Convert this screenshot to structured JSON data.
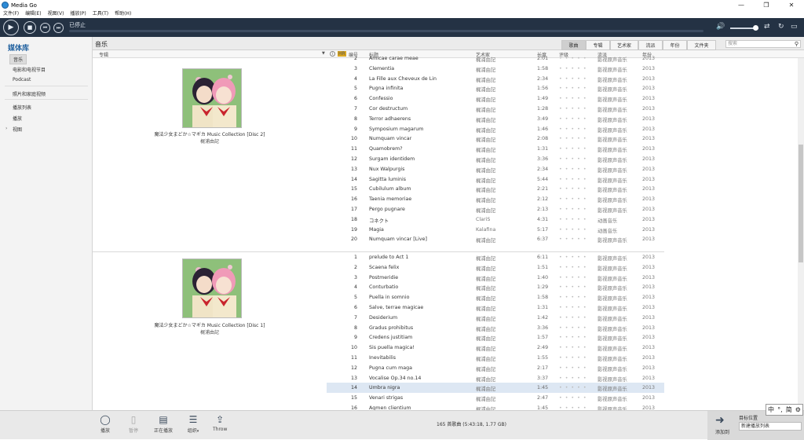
{
  "window": {
    "title": "Media Go",
    "minimize": "—",
    "restore": "❐",
    "close": "✕"
  },
  "menu": [
    "文件(F)",
    "编辑(E)",
    "视图(V)",
    "播放(P)",
    "工具(T)",
    "帮助(H)"
  ],
  "transport": {
    "status": "已停止"
  },
  "sidebar": {
    "title": "媒体库",
    "items": [
      "音乐",
      "电影和电视节目",
      "Podcast",
      "照片和家庭视频",
      "播放列表",
      "播放",
      "视图"
    ]
  },
  "section": {
    "title": "音乐",
    "view_tabs": [
      "歌曲",
      "专辑",
      "艺术家",
      "流派",
      "年份",
      "文件夹"
    ],
    "search_placeholder": "搜索"
  },
  "columns": {
    "album": "专辑",
    "hr": "HR",
    "number": "编号",
    "title": "标题",
    "artist": "艺术家",
    "length": "长度",
    "rating": "评级",
    "genre": "流派",
    "year": "年份"
  },
  "albums": [
    {
      "title": "魔法少女まどか☆マギカ Music Collection [Disc 2]",
      "artist": "梶浦由記"
    },
    {
      "title": "魔法少女まどか☆マギカ Music Collection [Disc 1]",
      "artist": "梶浦由記"
    }
  ],
  "tracks_disc2": [
    {
      "n": "2",
      "title": "Amicae carae meae",
      "artist": "梶浦由記",
      "len": "2:01",
      "genre": "影视原声音乐",
      "year": "2013"
    },
    {
      "n": "3",
      "title": "Clementia",
      "artist": "梶浦由記",
      "len": "1:58",
      "genre": "影视原声音乐",
      "year": "2013"
    },
    {
      "n": "4",
      "title": "La Fille aux Cheveux de Lin",
      "artist": "梶浦由記",
      "len": "2:34",
      "genre": "影视原声音乐",
      "year": "2013"
    },
    {
      "n": "5",
      "title": "Pugna infinita",
      "artist": "梶浦由記",
      "len": "1:56",
      "genre": "影视原声音乐",
      "year": "2013"
    },
    {
      "n": "6",
      "title": "Confessio",
      "artist": "梶浦由記",
      "len": "1:49",
      "genre": "影视原声音乐",
      "year": "2013"
    },
    {
      "n": "7",
      "title": "Cor destructum",
      "artist": "梶浦由記",
      "len": "1:28",
      "genre": "影视原声音乐",
      "year": "2013"
    },
    {
      "n": "8",
      "title": "Terror adhaerens",
      "artist": "梶浦由記",
      "len": "3:49",
      "genre": "影视原声音乐",
      "year": "2013"
    },
    {
      "n": "9",
      "title": "Symposium magarum",
      "artist": "梶浦由記",
      "len": "1:46",
      "genre": "影视原声音乐",
      "year": "2013"
    },
    {
      "n": "10",
      "title": "Numquam vincar",
      "artist": "梶浦由記",
      "len": "2:08",
      "genre": "影视原声音乐",
      "year": "2013"
    },
    {
      "n": "11",
      "title": "Quamobrem?",
      "artist": "梶浦由記",
      "len": "1:31",
      "genre": "影视原声音乐",
      "year": "2013"
    },
    {
      "n": "12",
      "title": "Surgam identidem",
      "artist": "梶浦由記",
      "len": "3:36",
      "genre": "影视原声音乐",
      "year": "2013"
    },
    {
      "n": "13",
      "title": "Nux Walpurgis",
      "artist": "梶浦由記",
      "len": "2:34",
      "genre": "影视原声音乐",
      "year": "2013"
    },
    {
      "n": "14",
      "title": "Sagitta luminis",
      "artist": "梶浦由記",
      "len": "5:44",
      "genre": "影视原声音乐",
      "year": "2013"
    },
    {
      "n": "15",
      "title": "Cubilulum album",
      "artist": "梶浦由記",
      "len": "2:21",
      "genre": "影视原声音乐",
      "year": "2013"
    },
    {
      "n": "16",
      "title": "Taenia memoriae",
      "artist": "梶浦由記",
      "len": "2:12",
      "genre": "影视原声音乐",
      "year": "2013"
    },
    {
      "n": "17",
      "title": "Pergo pugnare",
      "artist": "梶浦由記",
      "len": "2:13",
      "genre": "影视原声音乐",
      "year": "2013"
    },
    {
      "n": "18",
      "title": "コネクト",
      "artist": "ClariS",
      "len": "4:31",
      "genre": "动画音乐",
      "year": "2013"
    },
    {
      "n": "19",
      "title": "Magia",
      "artist": "Kalafina",
      "len": "5:17",
      "genre": "动画音乐",
      "year": "2013"
    },
    {
      "n": "20",
      "title": "Numquam vincar [Live]",
      "artist": "梶浦由記",
      "len": "6:37",
      "genre": "影视原声音乐",
      "year": "2013"
    }
  ],
  "tracks_disc1": [
    {
      "n": "1",
      "title": "prelude to Act 1",
      "artist": "梶浦由記",
      "len": "6:11",
      "genre": "影视原声音乐",
      "year": "2013"
    },
    {
      "n": "2",
      "title": "Scaena felix",
      "artist": "梶浦由記",
      "len": "1:51",
      "genre": "影视原声音乐",
      "year": "2013"
    },
    {
      "n": "3",
      "title": "Postmeridie",
      "artist": "梶浦由記",
      "len": "1:40",
      "genre": "影视原声音乐",
      "year": "2013"
    },
    {
      "n": "4",
      "title": "Conturbatio",
      "artist": "梶浦由記",
      "len": "1:29",
      "genre": "影视原声音乐",
      "year": "2013"
    },
    {
      "n": "5",
      "title": "Puella in somnio",
      "artist": "梶浦由記",
      "len": "1:58",
      "genre": "影视原声音乐",
      "year": "2013"
    },
    {
      "n": "6",
      "title": "Salve, terrae magicae",
      "artist": "梶浦由記",
      "len": "1:31",
      "genre": "影视原声音乐",
      "year": "2013"
    },
    {
      "n": "7",
      "title": "Desiderium",
      "artist": "梶浦由記",
      "len": "1:42",
      "genre": "影视原声音乐",
      "year": "2013"
    },
    {
      "n": "8",
      "title": "Gradus prohibitus",
      "artist": "梶浦由記",
      "len": "3:36",
      "genre": "影视原声音乐",
      "year": "2013"
    },
    {
      "n": "9",
      "title": "Credens justitiam",
      "artist": "梶浦由記",
      "len": "1:57",
      "genre": "影视原声音乐",
      "year": "2013"
    },
    {
      "n": "10",
      "title": "Sis puella magica!",
      "artist": "梶浦由記",
      "len": "2:49",
      "genre": "影视原声音乐",
      "year": "2013"
    },
    {
      "n": "11",
      "title": "Inevitabilis",
      "artist": "梶浦由記",
      "len": "1:55",
      "genre": "影视原声音乐",
      "year": "2013"
    },
    {
      "n": "12",
      "title": "Pugna cum maga",
      "artist": "梶浦由記",
      "len": "2:17",
      "genre": "影视原声音乐",
      "year": "2013"
    },
    {
      "n": "13",
      "title": "Vocalise Op.34 no.14",
      "artist": "梶浦由記",
      "len": "3:37",
      "genre": "影视原声音乐",
      "year": "2013"
    },
    {
      "n": "14",
      "title": "Umbra nigra",
      "artist": "梶浦由記",
      "len": "1:45",
      "genre": "影视原声音乐",
      "year": "2013"
    },
    {
      "n": "15",
      "title": "Venari strigas",
      "artist": "梶浦由記",
      "len": "2:47",
      "genre": "影视原声音乐",
      "year": "2013"
    },
    {
      "n": "16",
      "title": "Agmen clientium",
      "artist": "梶浦由記",
      "len": "1:45",
      "genre": "影视原声音乐",
      "year": "2013"
    }
  ],
  "highlighted_track": "Umbra nigra",
  "rating_stars": "• • • • •",
  "bottom": {
    "buttons": [
      "播放",
      "暂停",
      "正在播放",
      "组织",
      "Throw"
    ],
    "count": "165 首歌曲 (5:43:18, 1.77 GB)",
    "add_to": "添加到",
    "destination_label": "目标位置",
    "destination_value": "新建播放列表"
  },
  "ime": {
    "a": "中",
    "b": "°,",
    "c": "简",
    "d": "⚙"
  },
  "colors": {
    "transport_bg": "#243244",
    "accent": "#1e5f9e",
    "highlight_row": "#dde7f3"
  }
}
